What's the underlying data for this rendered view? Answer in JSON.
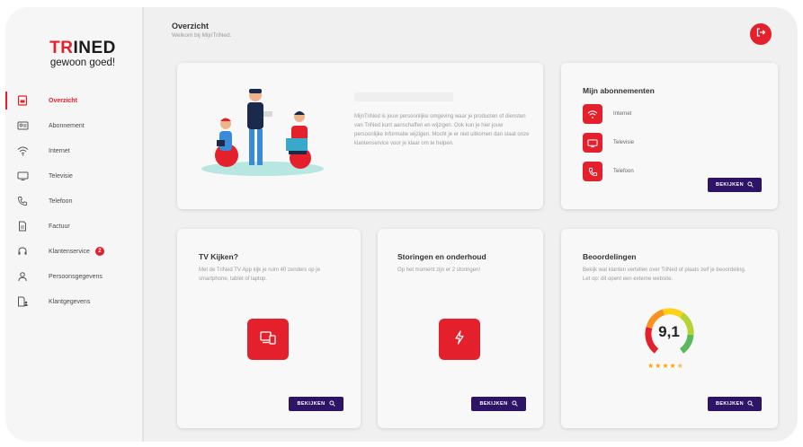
{
  "brand": {
    "logo_top": "TRINED",
    "logo_sub": "gewoon goed!",
    "accent": "#e3202b",
    "button_bg": "#2d1466"
  },
  "header": {
    "title": "Overzicht",
    "subtitle": "Welkom bij MijnTriNed."
  },
  "sidebar": {
    "items": [
      {
        "label": "Overzicht",
        "icon": "overview-icon",
        "active": true
      },
      {
        "label": "Abonnement",
        "icon": "subscription-card-icon"
      },
      {
        "label": "Internet",
        "icon": "wifi-icon"
      },
      {
        "label": "Televisie",
        "icon": "tv-icon"
      },
      {
        "label": "Telefoon",
        "icon": "phone-icon"
      },
      {
        "label": "Factuur",
        "icon": "invoice-icon"
      },
      {
        "label": "Klantenservice",
        "icon": "headset-icon",
        "badge": "2"
      },
      {
        "label": "Persoonsgegevens",
        "icon": "user-icon"
      },
      {
        "label": "Klantgegevens",
        "icon": "customer-data-icon"
      }
    ]
  },
  "welcome": {
    "text": "MijnTriNed is jouw persoonlijke omgeving waar je producten of diensten van TriNed kunt aanschaffen en wijzigen. Ook kun je hier jouw persoonlijke informatie wijzigen. Mocht je er niet uitkomen dan staat onze klantenservice voor je klaar om te helpen."
  },
  "subscriptions": {
    "title": "Mijn abonnementen",
    "items": [
      {
        "label": "Internet",
        "icon": "wifi-icon"
      },
      {
        "label": "Televisie",
        "icon": "tv-icon"
      },
      {
        "label": "Telefoon",
        "icon": "phone-icon"
      }
    ],
    "button": "BEKIJKEN"
  },
  "tv": {
    "title": "TV Kijken?",
    "text": "Met de TriNed TV App kijk je ruim 40 zenders op je smartphone, tablet of laptop.",
    "button": "BEKIJKEN"
  },
  "outages": {
    "title": "Storingen en onderhoud",
    "text": "Op het moment zijn er 2 storingen!",
    "button": "BEKIJKEN"
  },
  "reviews": {
    "title": "Beoordelingen",
    "text": "Bekijk wat klanten vertellen over TriNed of plaats zelf je beoordeling. Let op: dit opent een externe website.",
    "score": "9,1",
    "stars": 4.5,
    "button": "BEKIJKEN"
  }
}
